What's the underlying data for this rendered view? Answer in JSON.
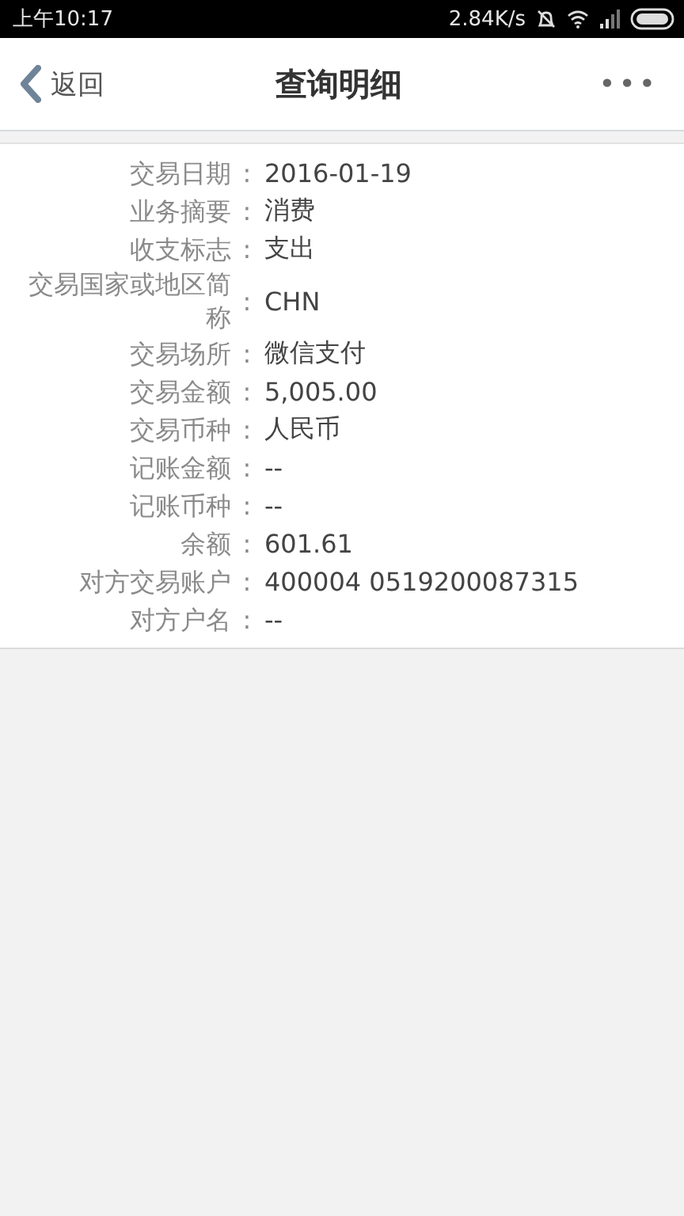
{
  "status_bar": {
    "time": "上午10:17",
    "speed": "2.84K/s"
  },
  "header": {
    "back": "返回",
    "title": "查询明细",
    "more": "•••"
  },
  "rows": [
    {
      "label": "交易日期",
      "colon": ":",
      "value": "2016-01-19"
    },
    {
      "label": "业务摘要",
      "colon": ":",
      "value": "消费"
    },
    {
      "label": "收支标志",
      "colon": ":",
      "value": "支出"
    },
    {
      "label": "交易国家或地区简称",
      "colon": ":",
      "value": "CHN"
    },
    {
      "label": "交易场所",
      "colon": ":",
      "value": "微信支付"
    },
    {
      "label": "交易金额",
      "colon": ":",
      "value": "5,005.00"
    },
    {
      "label": "交易币种",
      "colon": ":",
      "value": "人民币"
    },
    {
      "label": "记账金额",
      "colon": ":",
      "value": "--"
    },
    {
      "label": "记账币种",
      "colon": ":",
      "value": "--"
    },
    {
      "label": "余额",
      "colon": ":",
      "value": "601.61"
    },
    {
      "label": "对方交易账户",
      "colon": ":",
      "value": "400004 0519200087315"
    },
    {
      "label": "对方户名",
      "colon": ":",
      "value": "--"
    }
  ]
}
